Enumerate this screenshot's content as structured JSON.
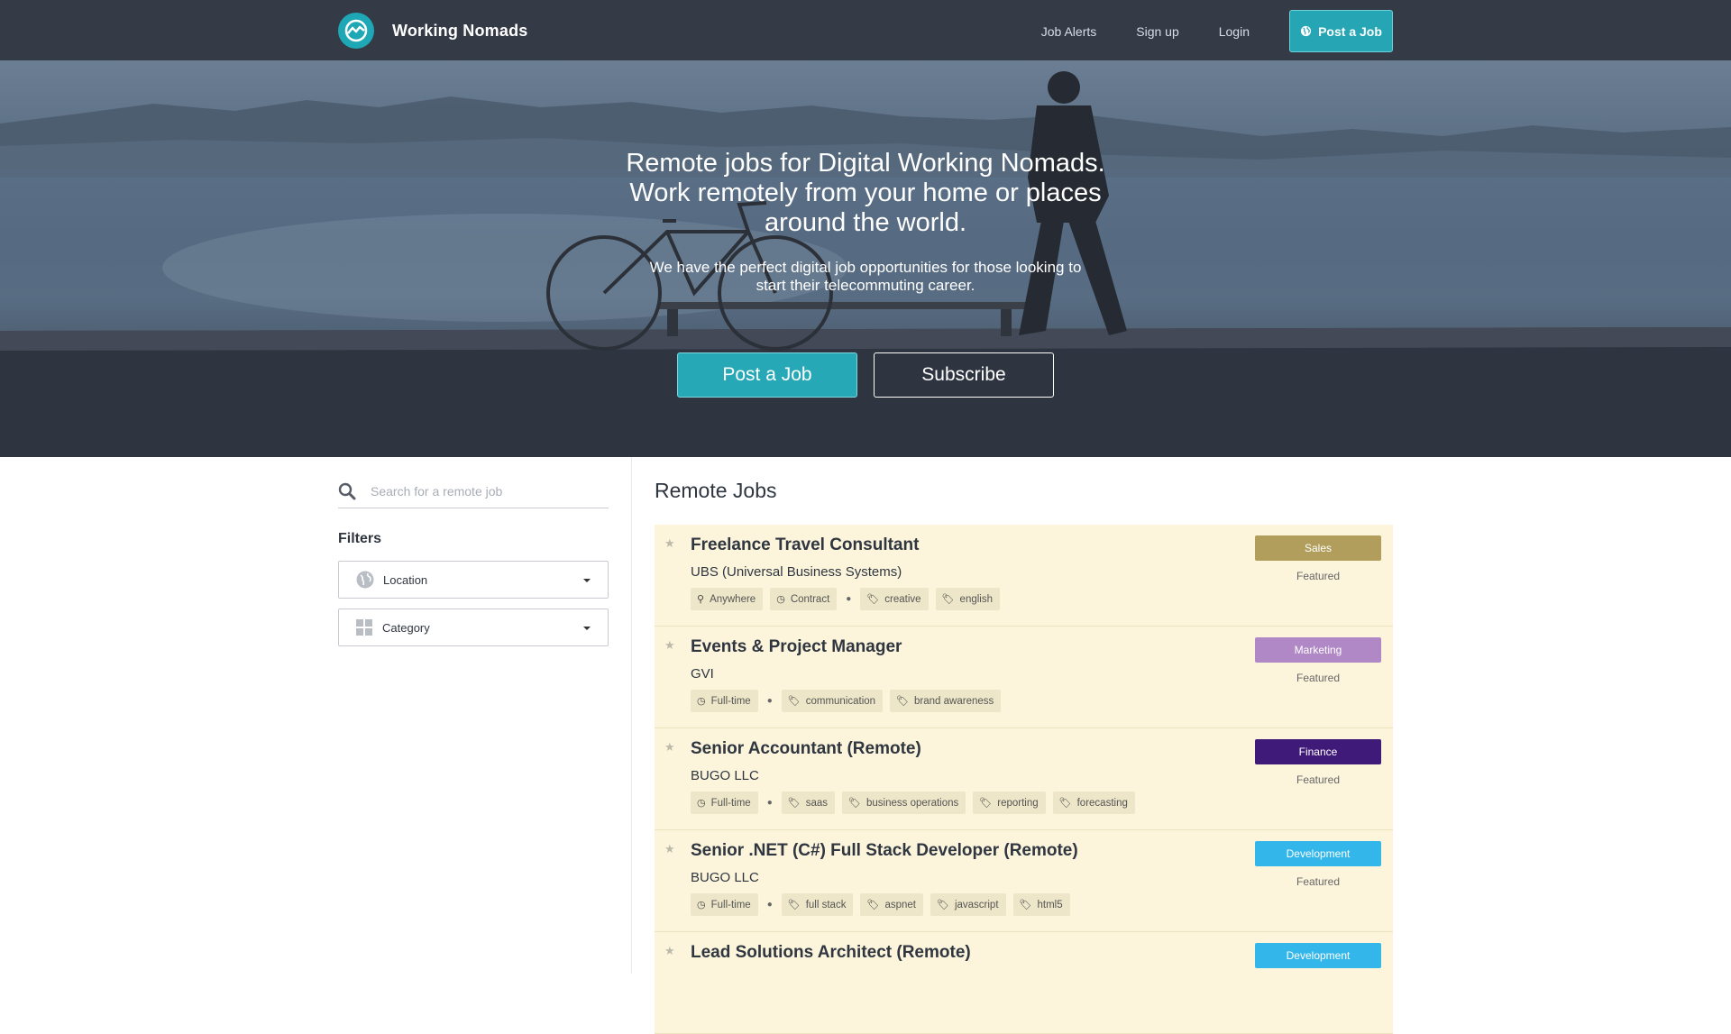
{
  "nav": {
    "brand": "Working Nomads",
    "links": [
      "Job Alerts",
      "Sign up",
      "Login"
    ],
    "post_button": "Post a Job"
  },
  "hero": {
    "title_lines": [
      "Remote jobs for Digital Working Nomads.",
      "Work remotely from your home or places",
      "around the world."
    ],
    "subtitle_lines": [
      "We have the perfect digital job opportunities for those looking to",
      "start their telecommuting career."
    ],
    "post_button": "Post a Job",
    "subscribe_button": "Subscribe"
  },
  "sidebar": {
    "search_placeholder": "Search for a remote job",
    "filters_title": "Filters",
    "location_label": "Location",
    "category_label": "Category"
  },
  "main": {
    "title": "Remote Jobs",
    "jobs": [
      {
        "title": "Freelance Travel Consultant",
        "company": "UBS (Universal Business Systems)",
        "meta": [
          {
            "icon": "map-marker-icon",
            "label": "Anywhere"
          },
          {
            "icon": "clock-icon",
            "label": "Contract"
          }
        ],
        "tags": [
          "creative",
          "english"
        ],
        "category": "Sales",
        "category_color": "#b29e5c",
        "featured": "Featured"
      },
      {
        "title": "Events & Project Manager",
        "company": "GVI",
        "meta": [
          {
            "icon": "clock-icon",
            "label": "Full-time"
          }
        ],
        "tags": [
          "communication",
          "brand awareness"
        ],
        "category": "Marketing",
        "category_color": "#b088c6",
        "featured": "Featured"
      },
      {
        "title": "Senior Accountant (Remote)",
        "company": "BUGO LLC",
        "meta": [
          {
            "icon": "clock-icon",
            "label": "Full-time"
          }
        ],
        "tags": [
          "saas",
          "business operations",
          "reporting",
          "forecasting"
        ],
        "category": "Finance",
        "category_color": "#3f1a78",
        "featured": "Featured"
      },
      {
        "title": "Senior .NET (C#) Full Stack Developer (Remote)",
        "company": "BUGO LLC",
        "meta": [
          {
            "icon": "clock-icon",
            "label": "Full-time"
          }
        ],
        "tags": [
          "full stack",
          "aspnet",
          "javascript",
          "html5"
        ],
        "category": "Development",
        "category_color": "#33b6ea",
        "featured": "Featured"
      },
      {
        "title": "Lead Solutions Architect (Remote)",
        "company": "",
        "meta": [],
        "tags": [],
        "category": "Development",
        "category_color": "#33b6ea",
        "featured": ""
      }
    ]
  }
}
